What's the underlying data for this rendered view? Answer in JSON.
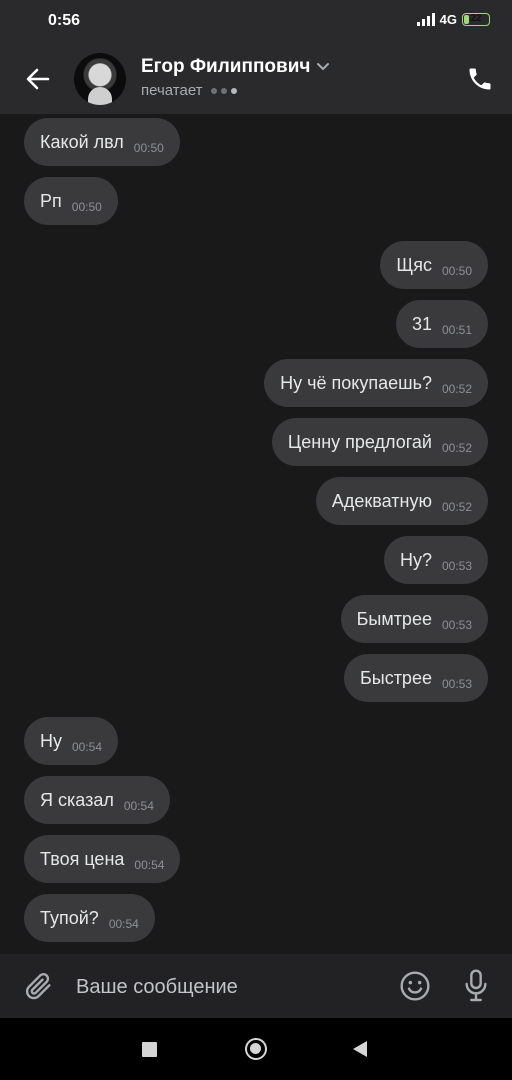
{
  "status_bar": {
    "time": "0:56",
    "network": "4G",
    "battery": "22",
    "battery_level": 0.22
  },
  "header": {
    "contact_name": "Егор Филиппович",
    "status": "печатает"
  },
  "messages": [
    {
      "text": "Какой лвл",
      "time": "00:50",
      "direction": "incoming"
    },
    {
      "text": "Рп",
      "time": "00:50",
      "direction": "incoming"
    },
    {
      "text": "Щяс",
      "time": "00:50",
      "direction": "outgoing"
    },
    {
      "text": "31",
      "time": "00:51",
      "direction": "outgoing"
    },
    {
      "text": "Ну чё покупаешь?",
      "time": "00:52",
      "direction": "outgoing"
    },
    {
      "text": "Ценну предлогай",
      "time": "00:52",
      "direction": "outgoing"
    },
    {
      "text": "Адекватную",
      "time": "00:52",
      "direction": "outgoing"
    },
    {
      "text": "Ну?",
      "time": "00:53",
      "direction": "outgoing"
    },
    {
      "text": "Бымтрее",
      "time": "00:53",
      "direction": "outgoing"
    },
    {
      "text": "Быстрее",
      "time": "00:53",
      "direction": "outgoing"
    },
    {
      "text": "Ну",
      "time": "00:54",
      "direction": "incoming"
    },
    {
      "text": "Я сказал",
      "time": "00:54",
      "direction": "incoming"
    },
    {
      "text": "Твоя цена",
      "time": "00:54",
      "direction": "incoming"
    },
    {
      "text": "Тупой?",
      "time": "00:54",
      "direction": "incoming"
    }
  ],
  "composer": {
    "placeholder": "Ваше сообщение"
  },
  "icons": {
    "back": "arrow-left-icon",
    "call": "phone-icon",
    "attach": "paperclip-icon",
    "emoji": "smiley-icon",
    "mic": "microphone-icon"
  },
  "colors": {
    "background": "#19191a",
    "bubble": "#3a3a3c",
    "header": "#2a2a2c"
  }
}
